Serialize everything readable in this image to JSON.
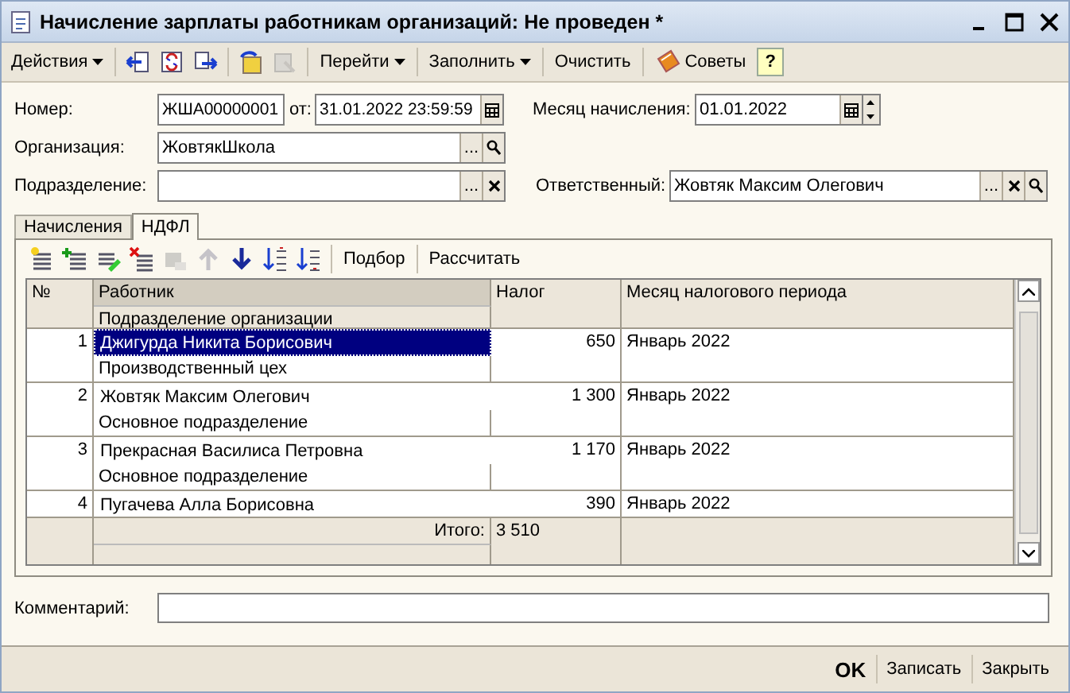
{
  "window": {
    "title": "Начисление зарплаты работникам организаций: Не проведен *"
  },
  "toolbar": {
    "items": [
      {
        "kind": "menu",
        "label": "Действия"
      },
      {
        "kind": "icon",
        "disabled": false
      },
      {
        "kind": "icon",
        "disabled": false
      },
      {
        "kind": "icon",
        "disabled": false
      },
      {
        "kind": "icon",
        "disabled": false
      },
      {
        "kind": "icon",
        "disabled": true
      },
      {
        "kind": "menu",
        "label": "Перейти"
      },
      {
        "kind": "menu",
        "label": "Заполнить"
      },
      {
        "kind": "button",
        "label": "Очистить"
      },
      {
        "kind": "tips",
        "label": "Советы"
      },
      {
        "kind": "help",
        "label": "?"
      }
    ]
  },
  "header": {
    "number_label": "Номер:",
    "number": "ЖША00000001",
    "date_label": "от:",
    "date": "31.01.2022 23:59:59",
    "month_label": "Месяц начисления:",
    "month": "01.01.2022",
    "organization_label": "Организация:",
    "organization": "ЖовтякШкола",
    "organization_button": "...",
    "department_label": "Подразделение:",
    "department_button": "...",
    "responsible_label": "Ответственный:",
    "responsible": "Жовтяк Максим Олегович",
    "responsible_button": "..."
  },
  "tabs": [
    {
      "label": "Начисления",
      "selected": false
    },
    {
      "label": "НДФЛ",
      "selected": true
    }
  ],
  "table_toolbar": {
    "items": [
      {
        "kind": "icon",
        "disabled": false
      },
      {
        "kind": "icon",
        "disabled": false
      },
      {
        "kind": "icon",
        "disabled": false
      },
      {
        "kind": "icon",
        "disabled": false
      },
      {
        "kind": "icon",
        "disabled": true
      },
      {
        "kind": "icon",
        "disabled": true
      },
      {
        "kind": "icon",
        "disabled": false
      },
      {
        "kind": "icon",
        "disabled": false
      },
      {
        "kind": "icon",
        "disabled": false
      },
      {
        "kind": "button",
        "label": "Подбор"
      },
      {
        "kind": "button",
        "label": "Рассчитать"
      }
    ]
  },
  "table": {
    "columns": [
      "№",
      "Работник",
      "Подразделение организации",
      "Налог",
      "Месяц налогового периода"
    ],
    "rows": [
      {
        "number": "1",
        "employee": "Джигурда Никита Борисович",
        "department": "Производственный цех",
        "tax": "650",
        "month": "Январь 2022",
        "selected": true
      },
      {
        "number": "2",
        "employee": "Жовтяк Максим Олегович",
        "department": "Основное подразделение",
        "tax": "1 300",
        "month": "Январь 2022",
        "selected": false
      },
      {
        "number": "3",
        "employee": "Прекрасная Василиса Петровна",
        "department": "Основное подразделение",
        "tax": "1 170",
        "month": "Январь 2022",
        "selected": false
      },
      {
        "number": "4",
        "employee": "Пугачева Алла Борисовна",
        "tax": "390",
        "month": "Январь 2022",
        "selected": false
      }
    ],
    "total_label": "Итого:",
    "total": "3 510"
  },
  "comment": {
    "label": "Комментарий:"
  },
  "buttons": [
    "OK",
    "Записать",
    "Закрыть"
  ]
}
